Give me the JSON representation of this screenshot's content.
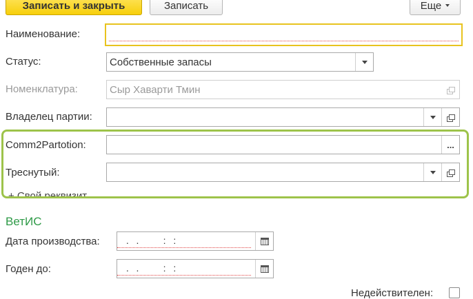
{
  "toolbar": {
    "save_close_label": "Записать и закрыть",
    "save_label": "Записать",
    "more_label": "Еще"
  },
  "form": {
    "name_label": "Наименование:",
    "name_value": "",
    "status_label": "Статус:",
    "status_value": "Собственные запасы",
    "nomenclature_label": "Номенклатура:",
    "nomenclature_value": "Сыр Хаварти Тмин",
    "owner_label": "Владелец партии:",
    "owner_value": "",
    "comm2_label": "Comm2Partotion:",
    "comm2_value": "",
    "comm2_button": "...",
    "cracked_label": "Треснутый:",
    "cracked_value": "",
    "add_attr_label": "+ Свой реквизит"
  },
  "vetis": {
    "section_title": "ВетИС",
    "production_date_label": "Дата производства:",
    "production_date_mask": " .  .       :  :",
    "expiry_label": "Годен до:",
    "expiry_mask": " .  .       :  :",
    "invalid_label": "Недействителен:",
    "invalid_checked": false
  },
  "colors": {
    "primary_button": "#f7cf0b",
    "focus_border": "#e8c31e",
    "highlight_border": "#9dc34a",
    "section_title": "#2e9a47",
    "required_underline": "#e04040"
  }
}
